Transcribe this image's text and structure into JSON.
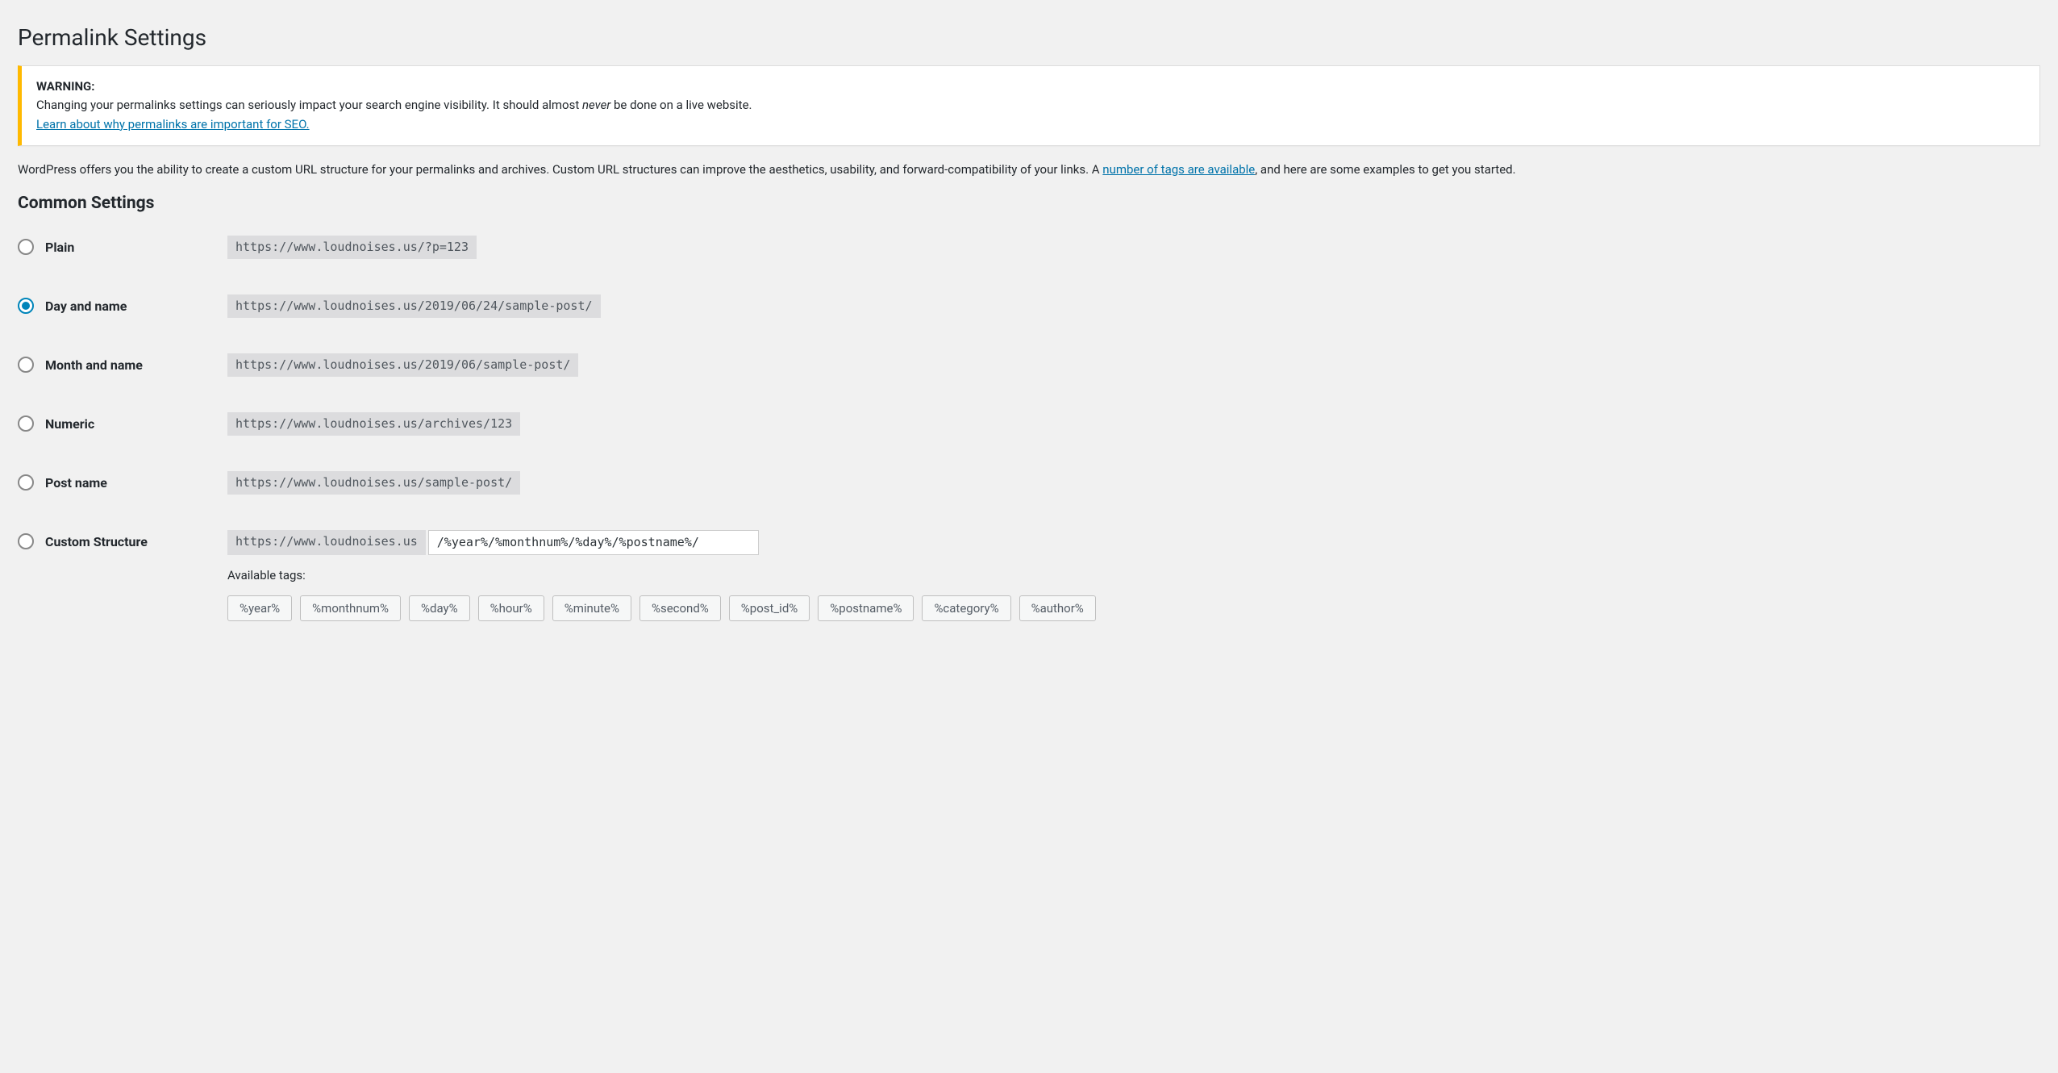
{
  "page_title": "Permalink Settings",
  "warning": {
    "label": "WARNING:",
    "text_before_em": "Changing your permalinks settings can seriously impact your search engine visibility. It should almost ",
    "text_em": "never",
    "text_after_em": " be done on a live website.",
    "link_text": "Learn about why permalinks are important for SEO."
  },
  "intro": {
    "text_before_link": "WordPress offers you the ability to create a custom URL structure for your permalinks and archives. Custom URL structures can improve the aesthetics, usability, and forward-compatibility of your links. A ",
    "link_text": "number of tags are available",
    "text_after_link": ", and here are some examples to get you started."
  },
  "section_heading": "Common Settings",
  "options": [
    {
      "label": "Plain",
      "example": "https://www.loudnoises.us/?p=123",
      "checked": false
    },
    {
      "label": "Day and name",
      "example": "https://www.loudnoises.us/2019/06/24/sample-post/",
      "checked": true
    },
    {
      "label": "Month and name",
      "example": "https://www.loudnoises.us/2019/06/sample-post/",
      "checked": false
    },
    {
      "label": "Numeric",
      "example": "https://www.loudnoises.us/archives/123",
      "checked": false
    },
    {
      "label": "Post name",
      "example": "https://www.loudnoises.us/sample-post/",
      "checked": false
    }
  ],
  "custom": {
    "label": "Custom Structure",
    "base_url": "https://www.loudnoises.us",
    "input_value": "/%year%/%monthnum%/%day%/%postname%/",
    "available_label": "Available tags:",
    "tags": [
      "%year%",
      "%monthnum%",
      "%day%",
      "%hour%",
      "%minute%",
      "%second%",
      "%post_id%",
      "%postname%",
      "%category%",
      "%author%"
    ]
  }
}
